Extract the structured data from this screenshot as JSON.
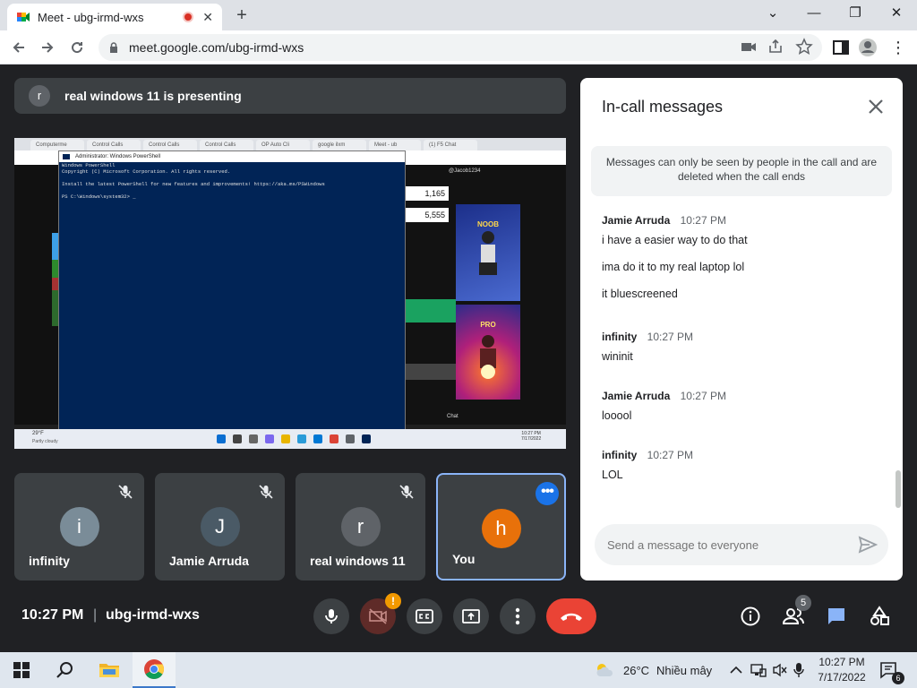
{
  "browser": {
    "tab_title": "Meet - ubg-irmd-wxs",
    "new_tab": "+",
    "url": "meet.google.com/ubg-irmd-wxs"
  },
  "meet": {
    "presenting_initial": "r",
    "presenting_text": "real windows 11 is presenting",
    "shared_screen": {
      "tabs": [
        "Computerme",
        "Control Calls",
        "Control Calls",
        "Control Calls",
        "OP Auto Cli",
        "google ilxm",
        "Meet - ub",
        "(1) F5 Chat"
      ],
      "ps_title": "Administrator: Windows PowerShell",
      "ps_lines": [
        "Windows PowerShell",
        "Copyright (C) Microsoft Corporation. All rights reserved.",
        "",
        "Install the latest PowerShell for new features and improvements! https://aka.ms/PSWindows",
        "",
        "PS C:\\Windows\\system32> _"
      ],
      "stat1": "1,165",
      "stat2": "5,555",
      "card1_label": "NOOB",
      "card2_label": "PRO",
      "chat_label": "Chat",
      "weather": "29°F",
      "weather_desc": "Partly cloudy",
      "clock": "10:27 PM",
      "date": "7/17/2022",
      "channel": "@Jacob1234"
    },
    "participants": [
      {
        "initial": "i",
        "name": "infinity",
        "color": "#7a8c98"
      },
      {
        "initial": "J",
        "name": "Jamie Arruda",
        "color": "#4a5a66"
      },
      {
        "initial": "r",
        "name": "real windows 11",
        "color": "#5f6368"
      },
      {
        "initial": "h",
        "name": "You",
        "color": "#e8710a"
      }
    ],
    "time": "10:27 PM",
    "separator": "|",
    "meeting_code": "ubg-irmd-wxs",
    "camera_alert": "!",
    "people_count": "5"
  },
  "chat": {
    "title": "In-call messages",
    "notice": "Messages can only be seen by people in the call and are deleted when the call ends",
    "messages": [
      {
        "sender": "Jamie Arruda",
        "time": "10:27 PM",
        "lines": [
          "i have a easier way to do that",
          "ima do it to my real laptop lol",
          "it bluescreened"
        ]
      },
      {
        "sender": "infinity",
        "time": "10:27 PM",
        "lines": [
          "wininit"
        ]
      },
      {
        "sender": "Jamie Arruda",
        "time": "10:27 PM",
        "lines": [
          "looool"
        ]
      },
      {
        "sender": "infinity",
        "time": "10:27 PM",
        "lines": [
          "LOL"
        ]
      }
    ],
    "input_placeholder": "Send a message to everyone"
  },
  "taskbar": {
    "temperature": "26°C",
    "weather": "Nhiều mây",
    "time": "10:27 PM",
    "date": "7/17/2022",
    "notifications": "6"
  },
  "colors": {
    "accent_blue": "#1a73e8",
    "end_call_red": "#ea4335",
    "meet_bg": "#202124"
  }
}
